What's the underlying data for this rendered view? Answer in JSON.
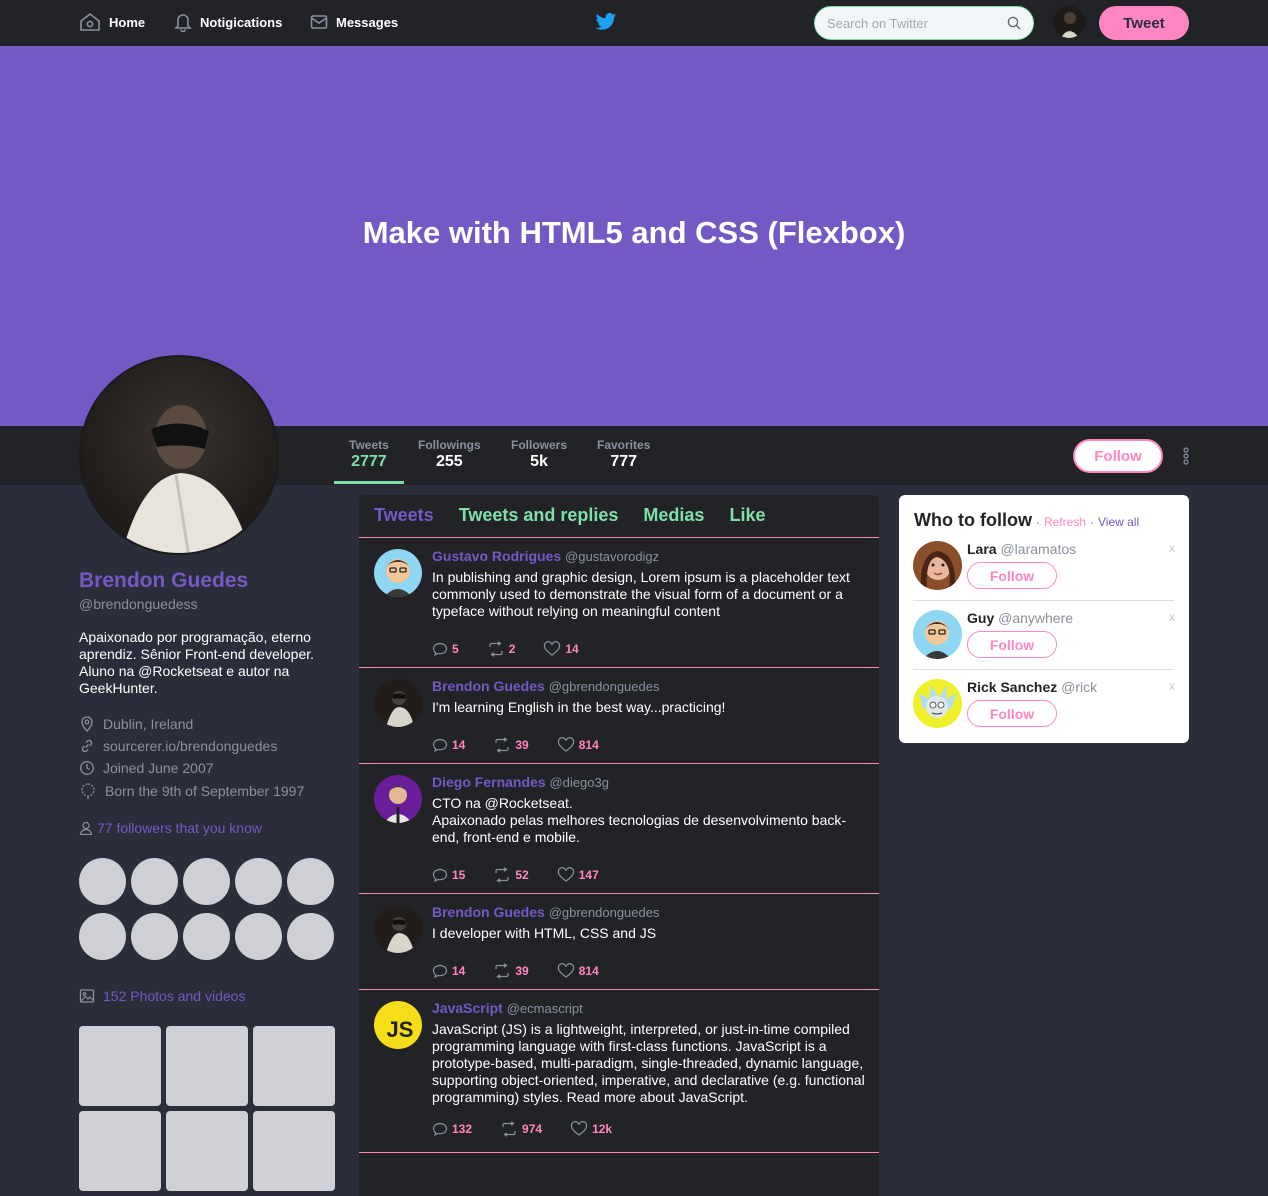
{
  "nav": {
    "home": "Home",
    "notifications": "Notigications",
    "messages": "Messages"
  },
  "search": {
    "placeholder": "Search on Twitter"
  },
  "top": {
    "tweet_label": "Tweet"
  },
  "banner": {
    "title": "Make with HTML5 and CSS (Flexbox)"
  },
  "stats": [
    {
      "label": "Tweets",
      "value": "2777"
    },
    {
      "label": "Followings",
      "value": "255"
    },
    {
      "label": "Followers",
      "value": "5k"
    },
    {
      "label": "Favorites",
      "value": "777"
    }
  ],
  "profile": {
    "follow_label": "Follow",
    "name": "Brendon Guedes",
    "handle": "@brendonguedess",
    "bio": "Apaixonado por programação, eterno aprendiz. Sênior Front-end developer. Aluno na @Rocketseat e autor na GeekHunter.",
    "location": "Dublin, Ireland",
    "website": "sourcerer.io/brendonguedes",
    "joined": "Joined June 2007",
    "born": "Born the 9th of September 1997",
    "followers_you_know": "77 followers that you know",
    "photos": "152 Photos and videos"
  },
  "tabs": [
    "Tweets",
    "Tweets and replies",
    "Medias",
    "Like"
  ],
  "tweets": [
    {
      "name": "Gustavo Rodrigues",
      "handle": "@gustavorodigz",
      "text": "In publishing and graphic design, Lorem ipsum is a placeholder text commonly used to demonstrate the visual form of a document or a typeface without relying on meaningful content",
      "replies": "5",
      "retweets": "2",
      "likes": "14"
    },
    {
      "name": "Brendon Guedes",
      "handle": "@gbrendonguedes",
      "text": "I'm learning English in the best way...practicing!",
      "replies": "14",
      "retweets": "39",
      "likes": "814"
    },
    {
      "name": "Diego Fernandes",
      "handle": "@diego3g",
      "text": "CTO na @Rocketseat.\nApaixonado pelas melhores tecnologias de desenvolvimento back-end, front-end e mobile.",
      "replies": "15",
      "retweets": "52",
      "likes": "147"
    },
    {
      "name": "Brendon Guedes",
      "handle": "@gbrendonguedes",
      "text": "I developer with HTML, CSS and JS",
      "replies": "14",
      "retweets": "39",
      "likes": "814"
    },
    {
      "name": "JavaScript",
      "handle": "@ecmascript",
      "text": "JavaScript (JS) is a lightweight, interpreted, or just-in-time compiled programming language with first-class functions. JavaScript is a prototype-based, multi-paradigm, single-threaded, dynamic language, supporting object-oriented, imperative, and declarative (e.g. functional programming) styles. Read more about JavaScript.",
      "replies": "132",
      "retweets": "974",
      "likes": "12k",
      "avatar_text": "JS"
    }
  ],
  "who_to_follow": {
    "title": "Who to follow",
    "sep": "·",
    "refresh": "Refresh",
    "view_all": "View all",
    "users": [
      {
        "name": "Lara",
        "handle": "@laramatos",
        "follow": "Follow",
        "close": "x"
      },
      {
        "name": "Guy",
        "handle": "@anywhere",
        "follow": "Follow",
        "close": "x"
      },
      {
        "name": "Rick Sanchez",
        "handle": "@rick",
        "follow": "Follow",
        "close": "x"
      }
    ]
  },
  "colors": {
    "accent": "#7459c4",
    "pink": "#ff86c1",
    "green": "#7ee0a8",
    "bar": "#222327",
    "bg": "#2b2d3a"
  }
}
